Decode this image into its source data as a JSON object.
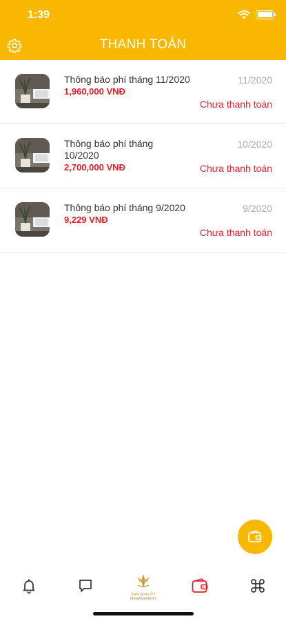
{
  "status_bar": {
    "time": "1:39",
    "wifi_icon": "wifi-icon",
    "battery_icon": "battery-icon"
  },
  "header": {
    "title": "THANH TOÁN",
    "settings_icon": "gear-icon"
  },
  "colors": {
    "brand": "#F9B800",
    "accent_red": "#e41e26",
    "muted": "#aaaaaa"
  },
  "payments": [
    {
      "title": "Thông báo phí tháng 11/2020",
      "amount": "1,960,000 VNĐ",
      "date": "11/2020",
      "status": "Chưa thanh toán"
    },
    {
      "title": "Thông báo phí tháng 10/2020",
      "amount": "2,700,000 VNĐ",
      "date": "10/2020",
      "status": "Chưa thanh toán"
    },
    {
      "title": "Thông báo phí tháng 9/2020",
      "amount": "9,229 VNĐ",
      "date": "9/2020",
      "status": "Chưa thanh toán"
    }
  ],
  "fab": {
    "icon": "wallet-icon"
  },
  "tabbar": {
    "items": [
      "bell-icon",
      "chat-icon",
      "logo",
      "wallet-icon",
      "command-icon"
    ],
    "logo_text_1": "SUN QUALITY",
    "logo_text_2": "MANAGEMENT"
  }
}
